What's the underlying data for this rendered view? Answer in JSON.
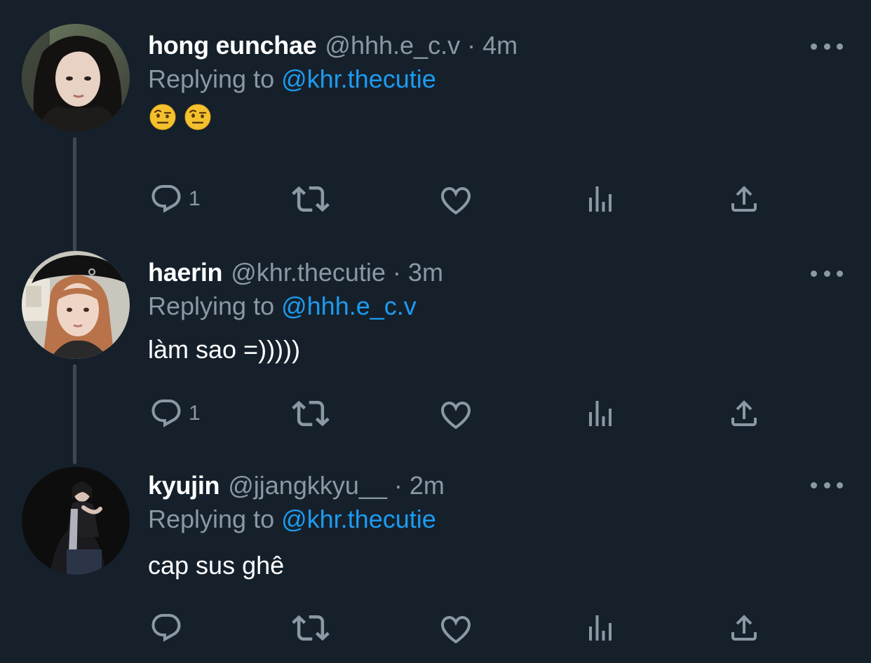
{
  "tweets": [
    {
      "name": "hong eunchae",
      "handle": "@hhh.e_c.v",
      "separator": "·",
      "time": "4m",
      "replying_prefix": "Replying to",
      "replying_to": "@khr.thecutie",
      "text": "",
      "emojis": [
        "face-with-raised-eyebrow",
        "face-with-raised-eyebrow"
      ],
      "reply_count": "1"
    },
    {
      "name": "haerin",
      "handle": "@khr.thecutie",
      "separator": "·",
      "time": "3m",
      "replying_prefix": "Replying to",
      "replying_to": "@hhh.e_c.v",
      "text": "làm sao =)))))",
      "reply_count": "1"
    },
    {
      "name": "kyujin",
      "handle": "@jjangkkyu__",
      "separator": "·",
      "time": "2m",
      "replying_prefix": "Replying to",
      "replying_to": "@khr.thecutie",
      "text": "cap sus ghê",
      "reply_count": ""
    }
  ],
  "icons": {
    "reply": "reply-icon",
    "retweet": "retweet-icon",
    "like": "like-icon",
    "views": "views-icon",
    "share": "share-icon",
    "more": "more-options-icon"
  },
  "colors": {
    "background": "#15202b",
    "name": "#ffffff",
    "muted": "#8b98a5",
    "link": "#1d9bf0",
    "thread_line": "#3d4854"
  }
}
